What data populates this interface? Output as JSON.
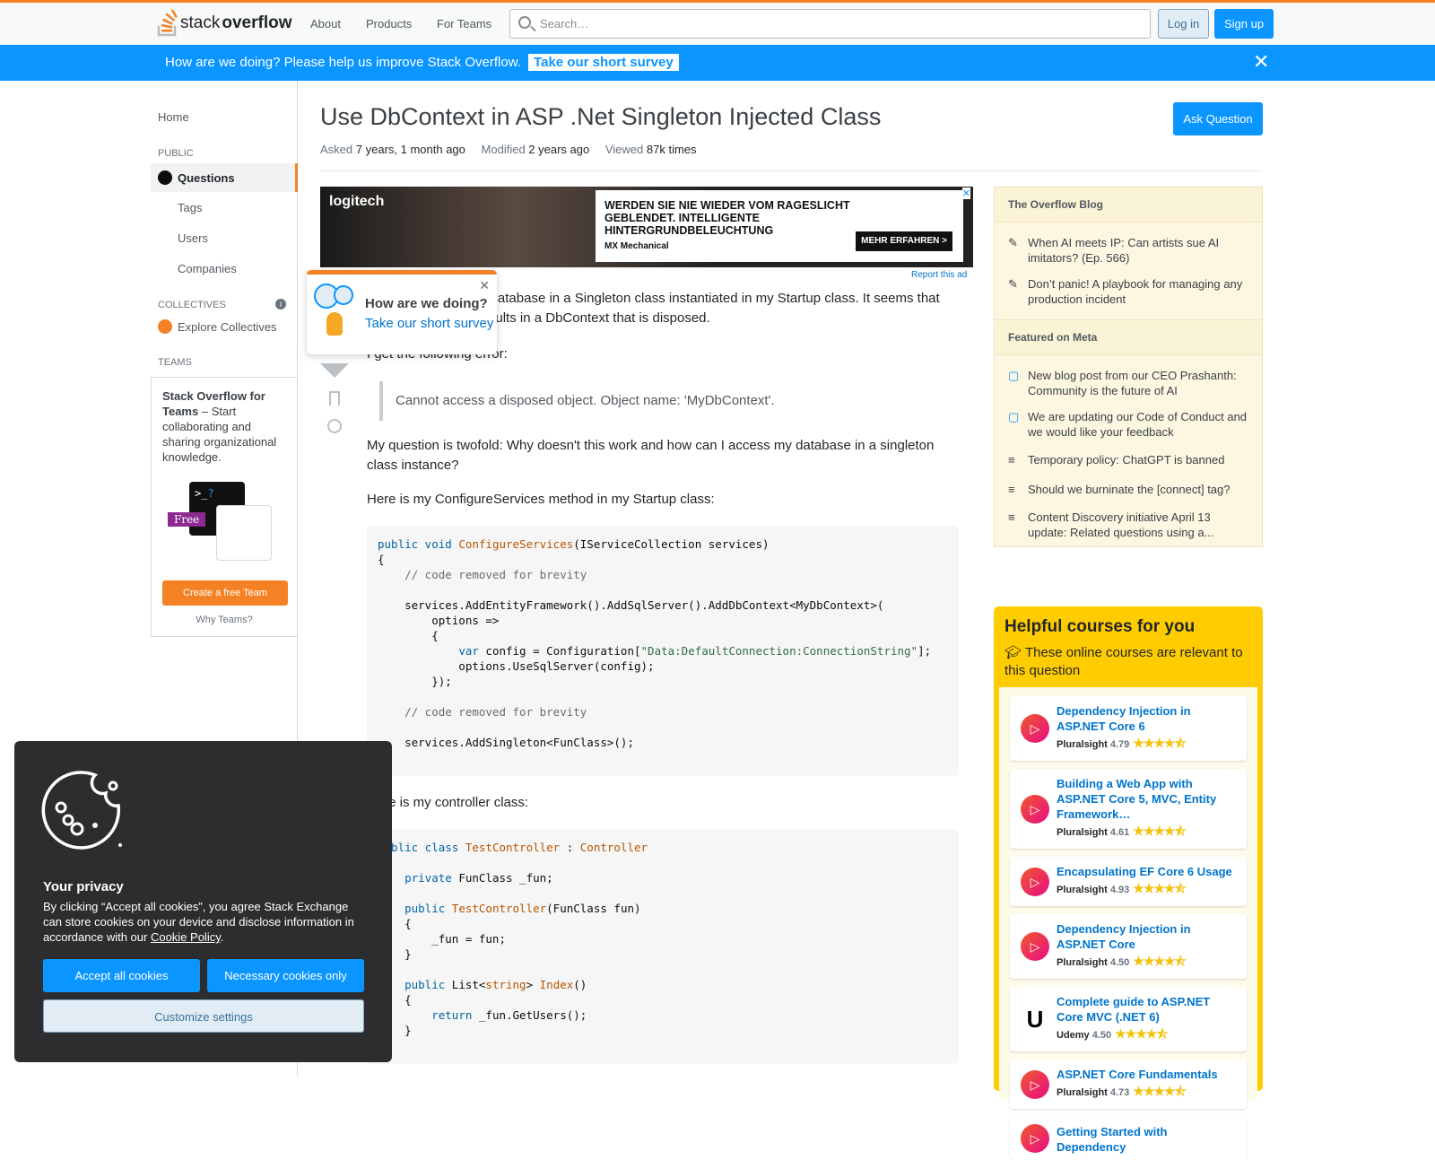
{
  "header": {
    "logo_text_1": "stack",
    "logo_text_2": "overflow",
    "nav": [
      "About",
      "Products",
      "For Teams"
    ],
    "search_placeholder": "Search…",
    "login": "Log in",
    "signup": "Sign up"
  },
  "banner": {
    "text": "How are we doing? Please help us improve Stack Overflow.",
    "link": "Take our short survey"
  },
  "sidebar": {
    "home": "Home",
    "public": "PUBLIC",
    "questions": "Questions",
    "tags": "Tags",
    "users": "Users",
    "companies": "Companies",
    "collectives": "COLLECTIVES",
    "explore": "Explore Collectives",
    "teams": "TEAMS",
    "teams_title": "Stack Overflow for Teams",
    "teams_desc": " – Start collaborating and sharing organizational knowledge.",
    "free": "Free",
    "create": "Create a free Team",
    "why": "Why Teams?"
  },
  "question": {
    "title": "Use DbContext in ASP .Net Singleton Injected Class",
    "ask": "Ask Question",
    "asked_label": "Asked",
    "asked": "7 years, 1 month ago",
    "modified_label": "Modified",
    "modified": "2 years ago",
    "viewed_label": "Viewed",
    "viewed": "87k times",
    "p1": "I need to access my database in a Singleton class instantiated in my Startup class. It seems that injecting it directly results in a DbContext that is disposed.",
    "p2": "I get the following error:",
    "quote": "Cannot access a disposed object. Object name: 'MyDbContext'.",
    "p3": "My question is twofold: Why doesn't this work and how can I access my database in a singleton class instance?",
    "p4": "Here is my ConfigureServices method in my Startup class:",
    "p5": "Here is my controller class:"
  },
  "code1": [
    [
      [
        "kw",
        "public void "
      ],
      [
        "ty",
        "ConfigureServices"
      ],
      [
        "",
        "(IServiceCollection services)"
      ]
    ],
    [
      [
        "",
        "{"
      ]
    ],
    [
      [
        "cm",
        "    // code removed for brevity"
      ]
    ],
    [
      [
        "",
        ""
      ]
    ],
    [
      [
        "",
        "    services.AddEntityFramework().AddSqlServer().AddDbContext<MyDbContext>("
      ]
    ],
    [
      [
        "",
        "        options =>"
      ]
    ],
    [
      [
        "",
        "        {"
      ]
    ],
    [
      [
        "",
        "            "
      ],
      [
        "kw",
        "var"
      ],
      [
        "",
        " config = Configuration["
      ],
      [
        "st",
        "\"Data:DefaultConnection:ConnectionString\""
      ],
      [
        "",
        "];"
      ]
    ],
    [
      [
        "",
        "            options.UseSqlServer(config);"
      ]
    ],
    [
      [
        "",
        "        });"
      ]
    ],
    [
      [
        "",
        ""
      ]
    ],
    [
      [
        "cm",
        "    // code removed for brevity"
      ]
    ],
    [
      [
        "",
        ""
      ]
    ],
    [
      [
        "",
        "    services.AddSingleton<FunClass>();"
      ]
    ]
  ],
  "code2": [
    [
      [
        "kw",
        "public class "
      ],
      [
        "ty",
        "TestController"
      ],
      [
        "",
        " : "
      ],
      [
        "ty",
        "Controller"
      ]
    ],
    [
      [
        "",
        "{"
      ]
    ],
    [
      [
        "",
        "    "
      ],
      [
        "kw",
        "private"
      ],
      [
        "",
        " FunClass _fun;"
      ]
    ],
    [
      [
        "",
        ""
      ]
    ],
    [
      [
        "",
        "    "
      ],
      [
        "kw",
        "public "
      ],
      [
        "ty",
        "TestController"
      ],
      [
        "",
        "(FunClass fun)"
      ]
    ],
    [
      [
        "",
        "    {"
      ]
    ],
    [
      [
        "",
        "        _fun = fun;"
      ]
    ],
    [
      [
        "",
        "    }"
      ]
    ],
    [
      [
        "",
        ""
      ]
    ],
    [
      [
        "",
        "    "
      ],
      [
        "kw",
        "public"
      ],
      [
        "",
        " List<"
      ],
      [
        "ty",
        "string"
      ],
      [
        "",
        "> "
      ],
      [
        "ty",
        "Index"
      ],
      [
        "",
        "()"
      ]
    ],
    [
      [
        "",
        "    {"
      ]
    ],
    [
      [
        "",
        "        "
      ],
      [
        "kw",
        "return"
      ],
      [
        "",
        " _fun.GetUsers();"
      ]
    ],
    [
      [
        "",
        "    }"
      ]
    ]
  ],
  "ad": {
    "brand": "logitech",
    "headline": "WERDEN SIE NIE WIEDER VOM RAGESLICHT GEBLENDET. INTELLIGENTE HINTERGRUNDBELEUCHTUNG",
    "product": "MX Mechanical",
    "cta": "MEHR ERFAHREN >",
    "report": "Report this ad"
  },
  "popup": {
    "title": "How are we doing?",
    "link": "Take our short survey"
  },
  "blog": {
    "title": "The Overflow Blog",
    "items": [
      "When AI meets IP: Can artists sue AI imitators? (Ep. 566)",
      "Don’t panic! A playbook for managing any production incident"
    ]
  },
  "meta_feat": {
    "title": "Featured on Meta",
    "items": [
      "New blog post from our CEO Prashanth: Community is the future of AI",
      "We are updating our Code of Conduct and we would like your feedback",
      "Temporary policy: ChatGPT is banned",
      "Should we burninate the [connect] tag?",
      "Content Discovery initiative April 13 update: Related questions using a..."
    ]
  },
  "courses": {
    "title": "Helpful courses for you",
    "sub": "These online courses are relevant to this question",
    "items": [
      {
        "title": "Dependency Injection in ASP.NET Core 6",
        "provider": "Pluralsight",
        "rating": "4.79"
      },
      {
        "title": "Building a Web App with ASP.NET Core 5, MVC, Entity Framework…",
        "provider": "Pluralsight",
        "rating": "4.61"
      },
      {
        "title": "Encapsulating EF Core 6 Usage",
        "provider": "Pluralsight",
        "rating": "4.93"
      },
      {
        "title": "Dependency Injection in ASP.NET Core",
        "provider": "Pluralsight",
        "rating": "4.50"
      },
      {
        "title": "Complete guide to ASP.NET Core MVC (.NET 6)",
        "provider": "Udemy",
        "rating": "4.50"
      },
      {
        "title": "ASP.NET Core Fundamentals",
        "provider": "Pluralsight",
        "rating": "4.73"
      },
      {
        "title": "Getting Started with Dependency",
        "provider": "Pluralsight",
        "rating": ""
      }
    ]
  },
  "cookie": {
    "title": "Your privacy",
    "desc": "By clicking “Accept all cookies”, you agree Stack Exchange can store cookies on your device and disclose information in accordance with our ",
    "policy": "Cookie Policy",
    "accept": "Accept all cookies",
    "necessary": "Necessary cookies only",
    "customize": "Customize settings"
  },
  "colors": {
    "accent": "#f48225",
    "primary": "#0a95ff",
    "courses_bg": "#ffcc01"
  }
}
